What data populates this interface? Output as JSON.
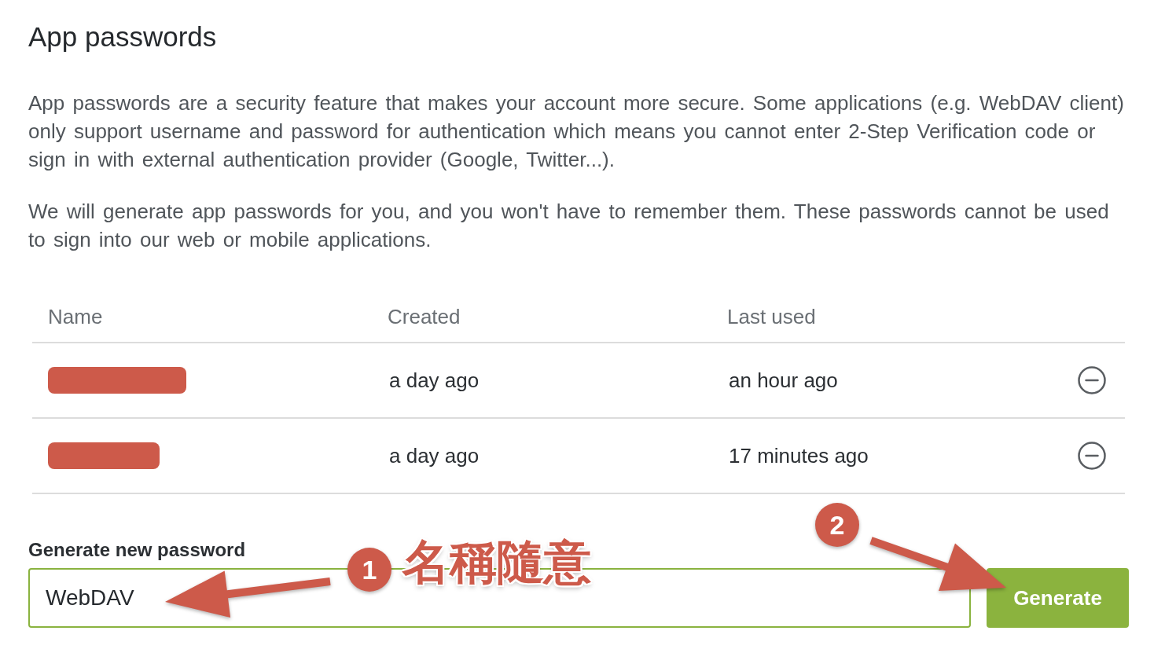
{
  "page": {
    "title": "App passwords"
  },
  "intro": [
    "App passwords are a security feature that makes your account more secure. Some applications (e.g. WebDAV client) only support username and password for authentication which means you cannot enter 2-Step Verification code or sign in with external authentication provider (Google, Twitter...).",
    "We will generate app passwords for you, and you won't have to remember them. These passwords cannot be used to sign into our web or mobile applications."
  ],
  "table": {
    "columns": [
      "Name",
      "Created",
      "Last used"
    ],
    "rows": [
      {
        "name_redacted": true,
        "created": "a day ago",
        "last_used": "an hour ago"
      },
      {
        "name_redacted": true,
        "created": "a day ago",
        "last_used": "17 minutes ago"
      }
    ]
  },
  "generate_form": {
    "label": "Generate new password",
    "value": "WebDAV",
    "button": "Generate"
  },
  "annotations": [
    {
      "kind": "step",
      "number": "1",
      "note": "名稱隨意"
    },
    {
      "kind": "step",
      "number": "2"
    }
  ]
}
